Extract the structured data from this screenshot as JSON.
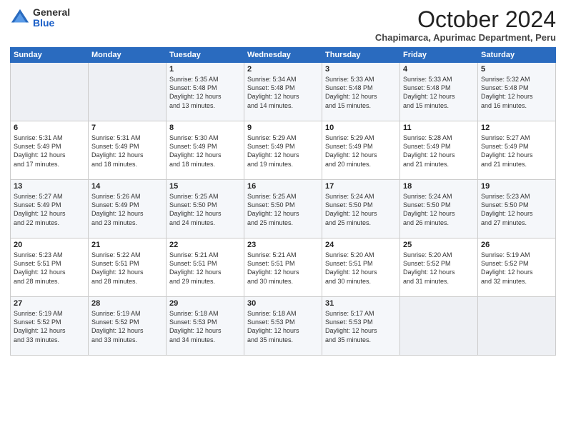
{
  "logo": {
    "general": "General",
    "blue": "Blue"
  },
  "header": {
    "month": "October 2024",
    "subtitle": "Chapimarca, Apurimac Department, Peru"
  },
  "weekdays": [
    "Sunday",
    "Monday",
    "Tuesday",
    "Wednesday",
    "Thursday",
    "Friday",
    "Saturday"
  ],
  "weeks": [
    [
      {
        "day": "",
        "info": ""
      },
      {
        "day": "",
        "info": ""
      },
      {
        "day": "1",
        "info": "Sunrise: 5:35 AM\nSunset: 5:48 PM\nDaylight: 12 hours\nand 13 minutes."
      },
      {
        "day": "2",
        "info": "Sunrise: 5:34 AM\nSunset: 5:48 PM\nDaylight: 12 hours\nand 14 minutes."
      },
      {
        "day": "3",
        "info": "Sunrise: 5:33 AM\nSunset: 5:48 PM\nDaylight: 12 hours\nand 15 minutes."
      },
      {
        "day": "4",
        "info": "Sunrise: 5:33 AM\nSunset: 5:48 PM\nDaylight: 12 hours\nand 15 minutes."
      },
      {
        "day": "5",
        "info": "Sunrise: 5:32 AM\nSunset: 5:48 PM\nDaylight: 12 hours\nand 16 minutes."
      }
    ],
    [
      {
        "day": "6",
        "info": "Sunrise: 5:31 AM\nSunset: 5:49 PM\nDaylight: 12 hours\nand 17 minutes."
      },
      {
        "day": "7",
        "info": "Sunrise: 5:31 AM\nSunset: 5:49 PM\nDaylight: 12 hours\nand 18 minutes."
      },
      {
        "day": "8",
        "info": "Sunrise: 5:30 AM\nSunset: 5:49 PM\nDaylight: 12 hours\nand 18 minutes."
      },
      {
        "day": "9",
        "info": "Sunrise: 5:29 AM\nSunset: 5:49 PM\nDaylight: 12 hours\nand 19 minutes."
      },
      {
        "day": "10",
        "info": "Sunrise: 5:29 AM\nSunset: 5:49 PM\nDaylight: 12 hours\nand 20 minutes."
      },
      {
        "day": "11",
        "info": "Sunrise: 5:28 AM\nSunset: 5:49 PM\nDaylight: 12 hours\nand 21 minutes."
      },
      {
        "day": "12",
        "info": "Sunrise: 5:27 AM\nSunset: 5:49 PM\nDaylight: 12 hours\nand 21 minutes."
      }
    ],
    [
      {
        "day": "13",
        "info": "Sunrise: 5:27 AM\nSunset: 5:49 PM\nDaylight: 12 hours\nand 22 minutes."
      },
      {
        "day": "14",
        "info": "Sunrise: 5:26 AM\nSunset: 5:49 PM\nDaylight: 12 hours\nand 23 minutes."
      },
      {
        "day": "15",
        "info": "Sunrise: 5:25 AM\nSunset: 5:50 PM\nDaylight: 12 hours\nand 24 minutes."
      },
      {
        "day": "16",
        "info": "Sunrise: 5:25 AM\nSunset: 5:50 PM\nDaylight: 12 hours\nand 25 minutes."
      },
      {
        "day": "17",
        "info": "Sunrise: 5:24 AM\nSunset: 5:50 PM\nDaylight: 12 hours\nand 25 minutes."
      },
      {
        "day": "18",
        "info": "Sunrise: 5:24 AM\nSunset: 5:50 PM\nDaylight: 12 hours\nand 26 minutes."
      },
      {
        "day": "19",
        "info": "Sunrise: 5:23 AM\nSunset: 5:50 PM\nDaylight: 12 hours\nand 27 minutes."
      }
    ],
    [
      {
        "day": "20",
        "info": "Sunrise: 5:23 AM\nSunset: 5:51 PM\nDaylight: 12 hours\nand 28 minutes."
      },
      {
        "day": "21",
        "info": "Sunrise: 5:22 AM\nSunset: 5:51 PM\nDaylight: 12 hours\nand 28 minutes."
      },
      {
        "day": "22",
        "info": "Sunrise: 5:21 AM\nSunset: 5:51 PM\nDaylight: 12 hours\nand 29 minutes."
      },
      {
        "day": "23",
        "info": "Sunrise: 5:21 AM\nSunset: 5:51 PM\nDaylight: 12 hours\nand 30 minutes."
      },
      {
        "day": "24",
        "info": "Sunrise: 5:20 AM\nSunset: 5:51 PM\nDaylight: 12 hours\nand 30 minutes."
      },
      {
        "day": "25",
        "info": "Sunrise: 5:20 AM\nSunset: 5:52 PM\nDaylight: 12 hours\nand 31 minutes."
      },
      {
        "day": "26",
        "info": "Sunrise: 5:19 AM\nSunset: 5:52 PM\nDaylight: 12 hours\nand 32 minutes."
      }
    ],
    [
      {
        "day": "27",
        "info": "Sunrise: 5:19 AM\nSunset: 5:52 PM\nDaylight: 12 hours\nand 33 minutes."
      },
      {
        "day": "28",
        "info": "Sunrise: 5:19 AM\nSunset: 5:52 PM\nDaylight: 12 hours\nand 33 minutes."
      },
      {
        "day": "29",
        "info": "Sunrise: 5:18 AM\nSunset: 5:53 PM\nDaylight: 12 hours\nand 34 minutes."
      },
      {
        "day": "30",
        "info": "Sunrise: 5:18 AM\nSunset: 5:53 PM\nDaylight: 12 hours\nand 35 minutes."
      },
      {
        "day": "31",
        "info": "Sunrise: 5:17 AM\nSunset: 5:53 PM\nDaylight: 12 hours\nand 35 minutes."
      },
      {
        "day": "",
        "info": ""
      },
      {
        "day": "",
        "info": ""
      }
    ]
  ]
}
